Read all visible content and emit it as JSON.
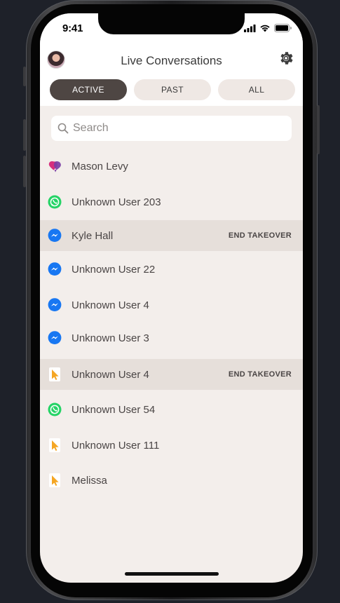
{
  "status": {
    "time": "9:41"
  },
  "header": {
    "title": "Live Conversations",
    "avatar_icon": "avatar",
    "settings_icon": "gear-icon"
  },
  "tabs": [
    {
      "label": "ACTIVE",
      "selected": true
    },
    {
      "label": "PAST",
      "selected": false
    },
    {
      "label": "ALL",
      "selected": false
    }
  ],
  "search": {
    "placeholder": "Search",
    "value": ""
  },
  "conversations": [
    {
      "name": "Mason Levy",
      "channel": "heart-chat-icon",
      "action": ""
    },
    {
      "name": "Unknown User 203",
      "channel": "whatsapp-icon",
      "action": ""
    },
    {
      "name": "Kyle Hall",
      "channel": "messenger-icon",
      "action": "END TAKEOVER"
    },
    {
      "name": "Unknown User 22",
      "channel": "messenger-icon",
      "action": ""
    },
    {
      "name": "Unknown User 4",
      "channel": "messenger-icon",
      "action": ""
    },
    {
      "name": "Unknown User 3",
      "channel": "messenger-icon",
      "action": ""
    },
    {
      "name": "Unknown User 4",
      "channel": "web-cursor-icon",
      "action": "END TAKEOVER"
    },
    {
      "name": "Unknown User 54",
      "channel": "whatsapp-icon",
      "action": ""
    },
    {
      "name": "Unknown User 111",
      "channel": "web-cursor-icon",
      "action": ""
    },
    {
      "name": "Melissa",
      "channel": "web-cursor-icon",
      "action": ""
    }
  ],
  "colors": {
    "active_tab": "#4e4643",
    "inactive_tab": "#efe8e4",
    "background": "#f3eeeb",
    "highlight_row": "#e6dfda",
    "whatsapp": "#25d366",
    "messenger": "#1877f2",
    "web": "#f5a623"
  }
}
